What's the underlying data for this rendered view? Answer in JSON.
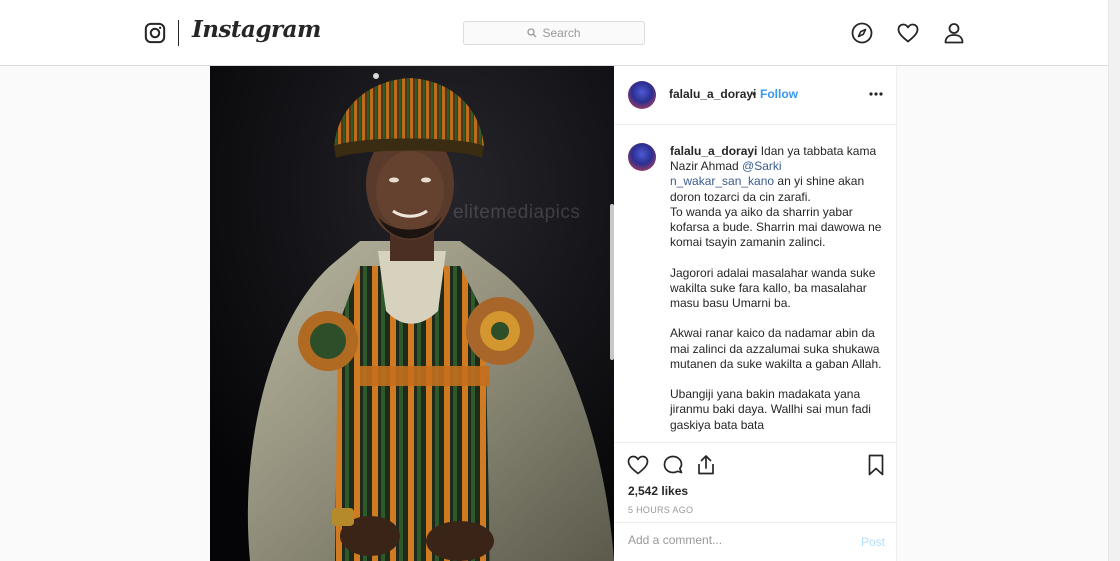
{
  "nav": {
    "wordmark": "Instagram",
    "search_placeholder": "Search",
    "icons": [
      "instagram-logo-icon",
      "compass-icon",
      "heart-icon",
      "user-icon"
    ]
  },
  "post": {
    "image_watermark": "elitemediapics",
    "header": {
      "username": "falalu_a_dorayi",
      "separator": "•",
      "follow_label": "Follow"
    },
    "caption": {
      "username": "falalu_a_dorayi",
      "text_before_mention": " Idan ya tabbata kama Nazir Ahmad ",
      "mention": "@Sarki n_wakar_san_kano",
      "text_after_mention": " an yi shine akan doron tozarci da cin zarafi.\nTo wanda ya aiko da sharrin yabar kofarsa a bude. Sharrin mai dawowa ne komai tsayin zamanin zalinci.\n\nJagorori adalai masalahar wanda suke wakilta suke fara kallo, ba masalahar masu basu Umarni ba.\n\nAkwai ranar kaico da nadamar abin da mai zalinci da azzalumai suka shukawa mutanen da suke wakilta a gaban Allah.\n\nUbangiji yana bakin madakata yana jiranmu baki daya. Wallhi sai mun fadi gaskiya bata bata"
    },
    "likes": "2,542 likes",
    "time_ago": "5 HOURS AGO",
    "comment_placeholder": "Add a comment...",
    "post_button": "Post"
  },
  "colors": {
    "link_blue": "#3897f0",
    "mention_blue": "#3b5c8f",
    "border": "#dbdbdb",
    "post_disabled": "#b2dffc"
  }
}
